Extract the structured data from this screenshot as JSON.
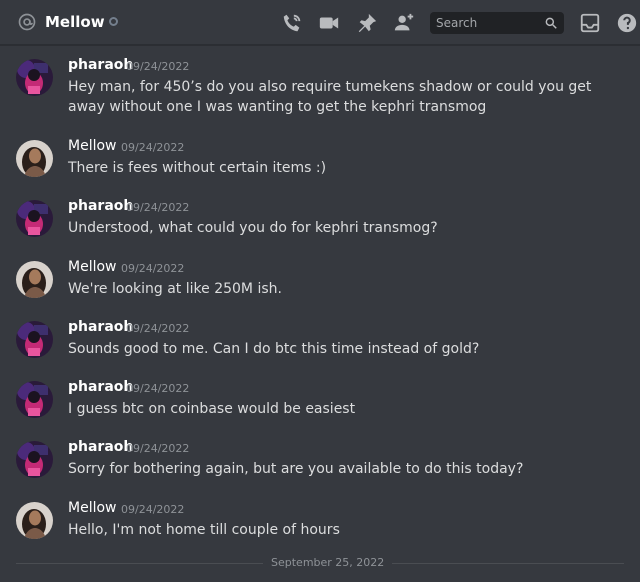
{
  "header": {
    "channel_name": "Mellow",
    "search_placeholder": "Search"
  },
  "messages": [
    {
      "author": "pharaoh",
      "timestamp": "09/24/2022",
      "text": "Hey man, for 450’s do you also require tumekens shadow or could you get away without one I was wanting to get the kephri transmog"
    },
    {
      "author": "Mellow",
      "timestamp": "09/24/2022",
      "text": "There is fees without certain items :)"
    },
    {
      "author": "pharaoh",
      "timestamp": "09/24/2022",
      "text": "Understood, what could you do for kephri transmog?"
    },
    {
      "author": "Mellow",
      "timestamp": "09/24/2022",
      "text": "We're looking at like 250M ish."
    },
    {
      "author": "pharaoh",
      "timestamp": "09/24/2022",
      "text": "Sounds good to me. Can I do btc this time instead of gold?"
    },
    {
      "author": "pharaoh",
      "timestamp": "09/24/2022",
      "text": "I guess btc on coinbase would be easiest"
    },
    {
      "author": "pharaoh",
      "timestamp": "09/24/2022",
      "text": "Sorry for bothering again, but are you available to do this today?"
    },
    {
      "author": "Mellow",
      "timestamp": "09/24/2022",
      "text": "Hello, I'm not home till couple of hours"
    }
  ],
  "date_divider": "September 25, 2022",
  "colors": {
    "background": "#36393f",
    "header_text": "#ffffff",
    "timestamp": "#8e9297",
    "message_text": "#dcddde",
    "search_bg": "#202225"
  },
  "icons": [
    "at-icon",
    "call-icon",
    "video-icon",
    "pin-icon",
    "add-member-icon",
    "search-icon",
    "inbox-icon",
    "help-icon"
  ]
}
